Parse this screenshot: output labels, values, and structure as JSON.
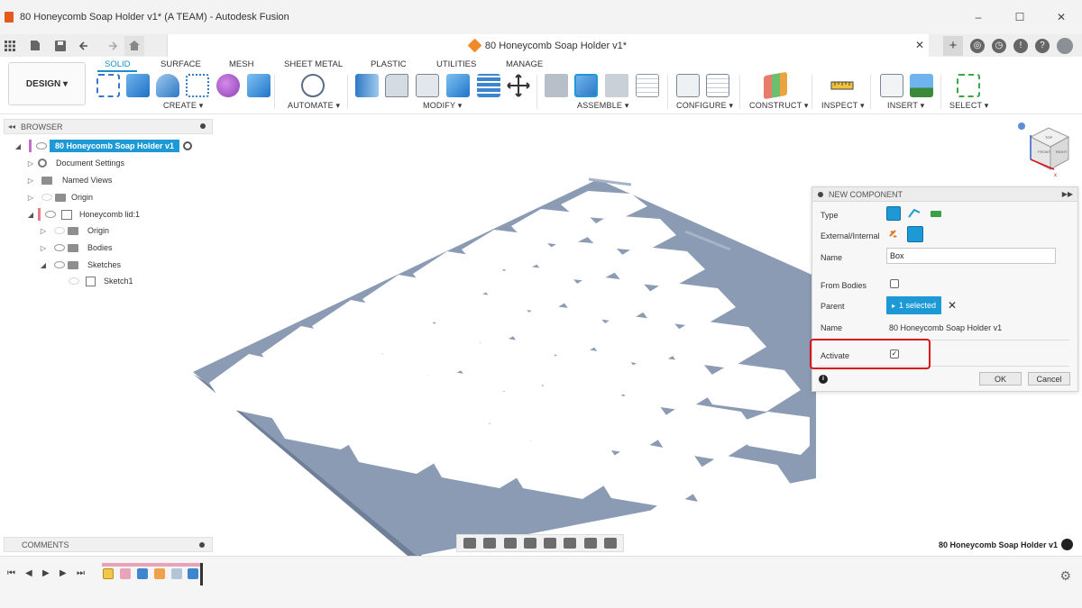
{
  "window": {
    "title": "80 Honeycomb Soap Holder v1* (A TEAM) - Autodesk Fusion",
    "controls": [
      "–",
      "☐",
      "✕"
    ]
  },
  "document_tab": {
    "label": "80 Honeycomb Soap Holder v1*",
    "close": "✕"
  },
  "workspace": {
    "label": "DESIGN ▾"
  },
  "toolbar_tabs": [
    "SOLID",
    "SURFACE",
    "MESH",
    "SHEET METAL",
    "PLASTIC",
    "UTILITIES",
    "MANAGE"
  ],
  "toolbar_groups": [
    "CREATE ▾",
    "AUTOMATE ▾",
    "MODIFY ▾",
    "ASSEMBLE ▾",
    "CONFIGURE ▾",
    "CONSTRUCT ▾",
    "INSPECT ▾",
    "INSERT ▾",
    "SELECT ▾"
  ],
  "browser": {
    "header": "BROWSER",
    "collapse": "◂◂",
    "root": "80 Honeycomb Soap Holder v1",
    "items": [
      {
        "label": "Document Settings",
        "expander": "▷"
      },
      {
        "label": "Named Views",
        "expander": "▷"
      },
      {
        "label": "Origin",
        "expander": "▷"
      },
      {
        "label": "Honeycomb lid:1",
        "expander": "◢"
      },
      {
        "label": "Origin",
        "expander": "▷"
      },
      {
        "label": "Bodies",
        "expander": "▷"
      },
      {
        "label": "Sketches",
        "expander": "◢"
      },
      {
        "label": "Sketch1",
        "expander": ""
      }
    ],
    "root_expander": "◢"
  },
  "dialog": {
    "title": "NEW COMPONENT",
    "expand": "▶▶",
    "type_label": "Type",
    "external_label": "External/Internal",
    "name_label": "Name",
    "name_value": "Box",
    "from_bodies_label": "From Bodies",
    "parent_label": "Parent",
    "parent_value": "1 selected",
    "parent_clear": "✕",
    "parent_name_label": "Name",
    "parent_name_value": "80 Honeycomb Soap Holder v1",
    "activate_label": "Activate",
    "activate_check": "✓",
    "ok": "OK",
    "cancel": "Cancel",
    "info": "i"
  },
  "comments": {
    "header": "COMMENTS"
  },
  "status": {
    "document_name": "80 Honeycomb Soap Holder v1"
  },
  "timeline": {
    "controls": [
      "⏮",
      "◀",
      "▶",
      "▶",
      "⏭"
    ],
    "settings": "⚙"
  },
  "colors": {
    "accent": "#1d9ad6",
    "highlight": "#d9141b",
    "model": "#8b9bb4"
  }
}
